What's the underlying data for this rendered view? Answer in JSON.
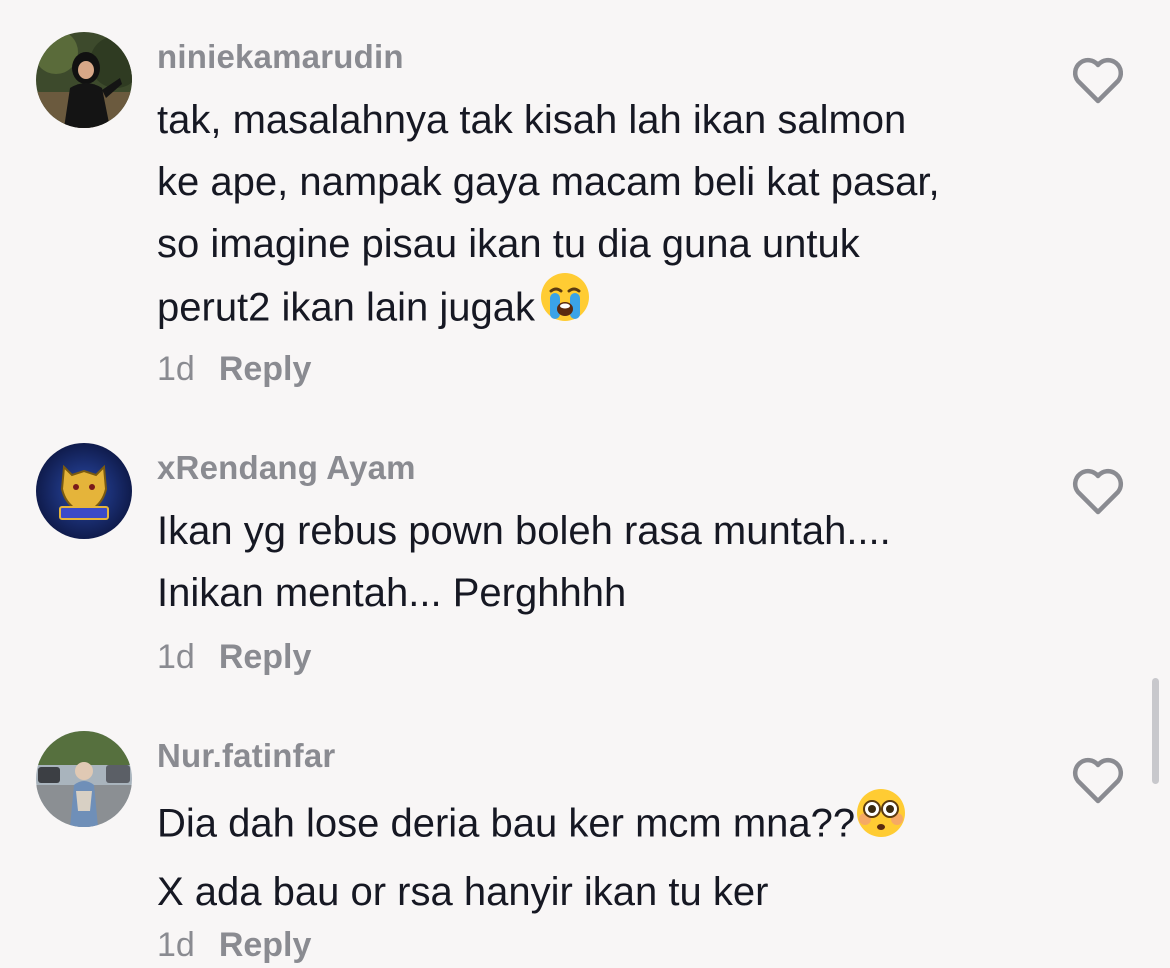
{
  "comments": [
    {
      "username": "niniekamarudin",
      "text": "tak, masalahnya tak kisah lah ikan salmon\nke ape, nampak gaya macam beli kat pasar,\nso imagine pisau ikan tu dia guna untuk\nperut2 ikan lain jugak",
      "emoji": "loudly-crying-face",
      "time": "1d",
      "reply_label": "Reply"
    },
    {
      "username": "xRendang Ayam",
      "text": "Ikan yg rebus pown boleh rasa muntah....\nInikan mentah... Perghhhh",
      "time": "1d",
      "reply_label": "Reply"
    },
    {
      "username": "Nur.fatinfar",
      "text_line1": "Dia dah lose deria bau ker mcm mna??",
      "text_line2": "X ada bau or rsa hanyir ikan tu ker",
      "emoji": "flushed-face",
      "time": "1d",
      "reply_label": "Reply"
    }
  ],
  "icons": {
    "like": "heart-outline-icon"
  },
  "colors": {
    "background": "#f8f6f6",
    "username": "#8a8b91",
    "text": "#161823",
    "meta": "#8a8b91"
  }
}
